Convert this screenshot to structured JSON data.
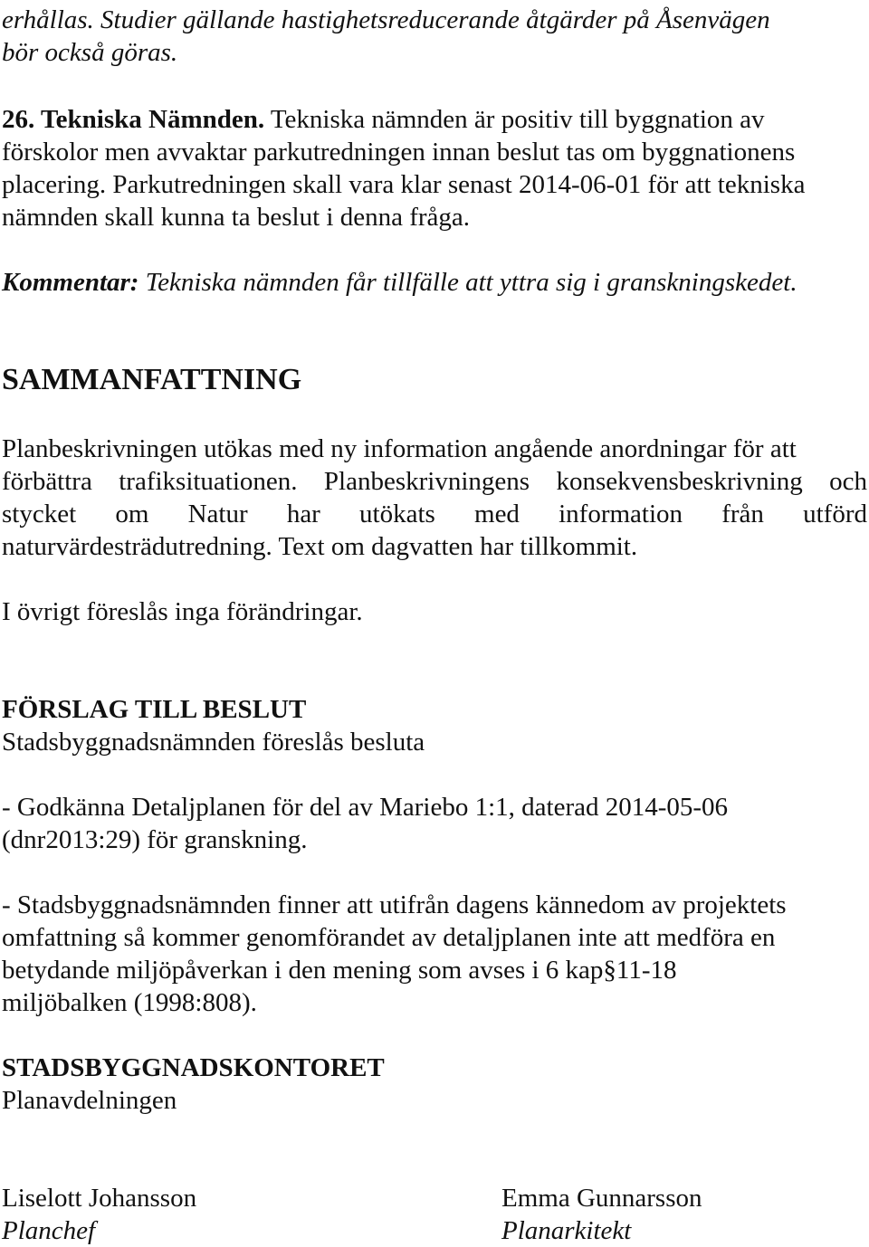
{
  "intro": {
    "lines": [
      "erhållas. Studier gällande hastighetsreducerande åtgärder på Åsenvägen",
      "bör också göras."
    ]
  },
  "item26": {
    "label": "26. Tekniska Nämnden.",
    "line1_rest": " Tekniska nämnden är positiv till byggnation av",
    "lines": [
      "förskolor men avvaktar parkutredningen innan beslut tas om byggnationens",
      "placering. Parkutredningen skall vara klar senast 2014-06-01 för att tekniska",
      "nämnden skall kunna ta beslut i denna fråga."
    ],
    "comment_label": "Kommentar:",
    "comment_text": " Tekniska nämnden får tillfälle att yttra sig i granskningskedet."
  },
  "summary": {
    "heading": "SAMMANFATTNING",
    "lines": [
      "Planbeskrivningen utökas med ny information angående anordningar för att",
      "förbättra trafiksituationen. Planbeskrivningens konsekvensbeskrivning och",
      "stycket om Natur har utökats med information från utförd",
      "naturvärdesträdutredning. Text om dagvatten har tillkommit."
    ],
    "other": "I övrigt föreslås inga förändringar."
  },
  "proposal": {
    "heading": "FÖRSLAG TILL BESLUT",
    "intro": "Stadsbyggnadsnämnden föreslås besluta",
    "point1": [
      "- Godkänna Detaljplanen för del av Mariebo 1:1, daterad 2014-05-06",
      "(dnr2013:29) för granskning."
    ],
    "point2": [
      "- Stadsbyggnadsnämnden finner att utifrån dagens kännedom av projektets",
      "omfattning så kommer genomförandet av detaljplanen inte att medföra en",
      "betydande miljöpåverkan i den mening som avses i 6 kap§11-18",
      "miljöbalken (1998:808)."
    ]
  },
  "office": {
    "name": "STADSBYGGNADSKONTORET",
    "department": "Planavdelningen"
  },
  "signatures": [
    {
      "name": "Liselott Johansson",
      "title": "Planchef"
    },
    {
      "name": "Emma Gunnarsson",
      "title": "Planarkitekt"
    }
  ]
}
